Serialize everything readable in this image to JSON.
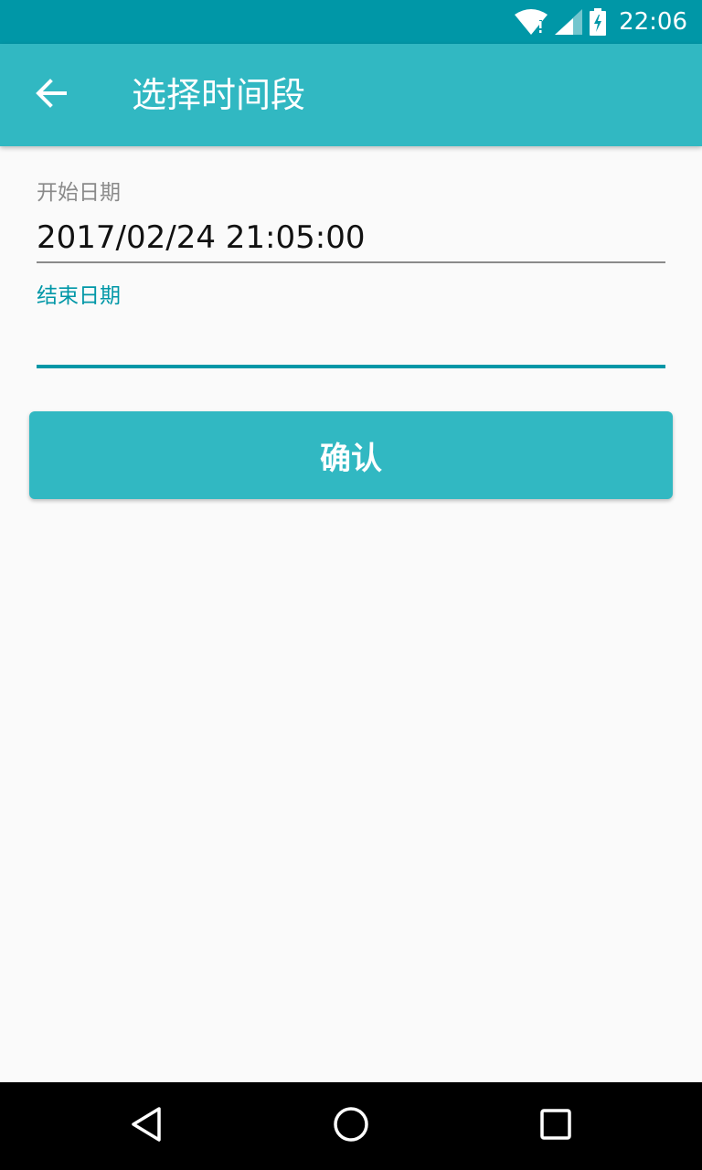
{
  "status_bar": {
    "time": "22:06",
    "icons": [
      "wifi-icon",
      "signal-icon",
      "battery-charging-icon"
    ]
  },
  "app_bar": {
    "title": "选择时间段",
    "back_icon": "arrow-back-icon"
  },
  "form": {
    "start_label": "开始日期",
    "start_value": "2017/02/24 21:05:00",
    "end_label": "结束日期",
    "end_value": ""
  },
  "confirm_button": {
    "label": "确认"
  },
  "nav_bar": {
    "icons": [
      "back-triangle-icon",
      "home-circle-icon",
      "recents-square-icon"
    ]
  },
  "colors": {
    "status_bar": "#0097a7",
    "app_bar": "#31b8c2",
    "accent": "#0097a7",
    "background": "#fafafa"
  }
}
